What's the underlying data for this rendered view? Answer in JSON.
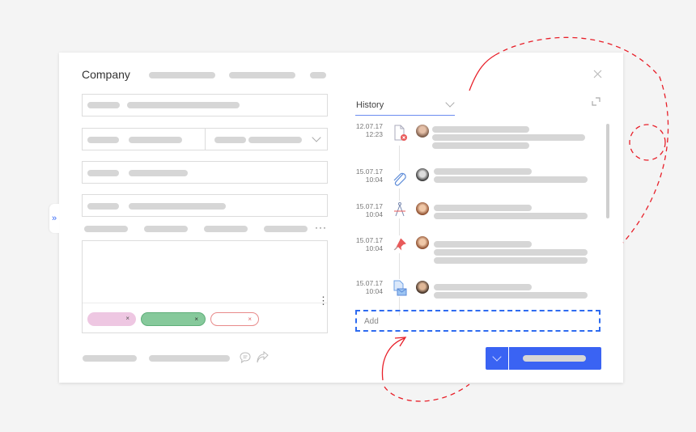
{
  "header": {
    "title": "Company",
    "close_icon": "close-icon",
    "expand_icon": "expand-icon"
  },
  "sidebar_toggle": {
    "icon": "double-chevron-right-icon",
    "glyph": "»"
  },
  "form": {
    "more_glyph": "···",
    "vertical_more_glyph": "⋮",
    "tags": [
      {
        "color": "#eec7e2",
        "remove": "×"
      },
      {
        "color": "#86c99b",
        "remove": "×"
      },
      {
        "color": "#ffffff",
        "border": "#e88a8a",
        "remove": "×"
      }
    ],
    "footer_icons": [
      "comment-icon",
      "share-icon"
    ]
  },
  "history": {
    "dropdown_label": "History",
    "accent": "#6b8cf0",
    "entries": [
      {
        "date": "12.07.17",
        "time": "12:23",
        "icon": "document-error-icon"
      },
      {
        "date": "15.07.17",
        "time": "10:04",
        "icon": "paperclip-icon"
      },
      {
        "date": "15.07.17",
        "time": "10:04",
        "icon": "compass-icon"
      },
      {
        "date": "15.07.17",
        "time": "10:04",
        "icon": "pin-icon"
      },
      {
        "date": "15.07.17",
        "time": "10:04",
        "icon": "document-mail-icon"
      }
    ],
    "add_placeholder": "Add"
  },
  "actions": {
    "primary_color": "#3a63f3"
  },
  "annotation_color": "#e8202a"
}
